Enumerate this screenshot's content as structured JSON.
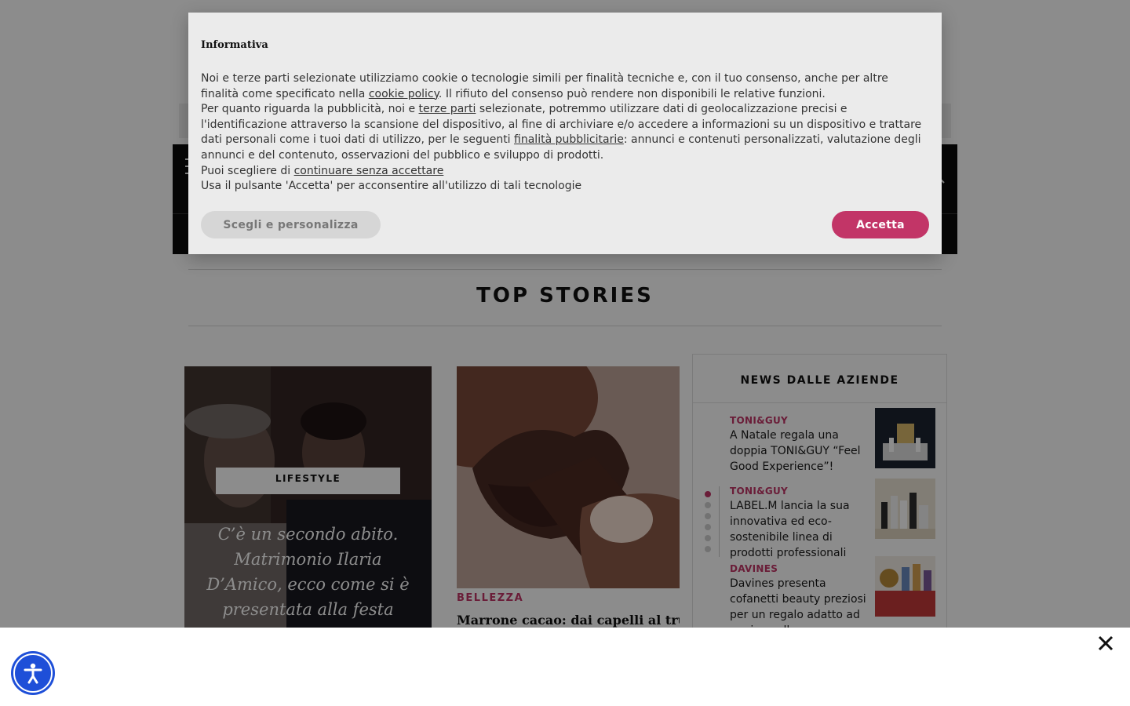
{
  "colors": {
    "accent": "#c23567",
    "dark": "#0e0e0e",
    "a11y": "#1e4fd8"
  },
  "section": {
    "title": "TOP STORIES"
  },
  "card1": {
    "category": "LIFESTYLE",
    "title": "C’è un secondo abito. Matrimonio Ilaria D’Amico, ecco come si è presentata alla festa"
  },
  "card2": {
    "category": "BELLEZZA",
    "title": "Marrone cacao: dai capelli al trucco il"
  },
  "news": {
    "title": "NEWS DALLE AZIENDE",
    "active_slide": 1,
    "slide_count": 6,
    "items": [
      {
        "brand": "TONI&GUY",
        "headline": "A Natale regala una doppia TONI&GUY “Feel Good Experience”!"
      },
      {
        "brand": "TONI&GUY",
        "headline": "LABEL.M lancia la sua innovativa ed eco-sostenibile linea di prodotti professionali"
      },
      {
        "brand": "DAVINES",
        "headline": "Davines presenta cofanetti beauty preziosi per un regalo adatto ad ogni capello"
      }
    ]
  },
  "modal": {
    "title": "Informativa",
    "p1_a": "Noi e terze parti selezionate utilizziamo cookie o tecnologie simili per finalità tecniche e, con il tuo consenso, anche per altre finalità come specificato nella ",
    "p1_link": "cookie policy",
    "p1_b": ". Il rifiuto del consenso può rendere non disponibili le relative funzioni.",
    "p2_a": "Per quanto riguarda la pubblicità, noi e ",
    "p2_link1": "terze parti",
    "p2_b": " selezionate, potremmo utilizzare dati di geolocalizzazione precisi e l'identificazione attraverso la scansione del dispositivo, al fine di archiviare e/o accedere a informazioni su un dispositivo e trattare dati personali come i tuoi dati di utilizzo, per le seguenti ",
    "p2_link2": "finalità pubblicitarie",
    "p2_c": ": annunci e contenuti personalizzati, valutazione degli annunci e del contenuto, osservazioni del pubblico e sviluppo di prodotti.",
    "p3_a": "Puoi scegliere di ",
    "p3_link": "continuare senza accettare",
    "p4": "Usa il pulsante 'Accetta' per acconsentire all'utilizzo di tali tecnologie",
    "btn_customize": "Scegli e personalizza",
    "btn_accept": "Accetta"
  },
  "icons": {
    "menu": "hamburger-icon",
    "search": "search-icon",
    "close": "close-icon",
    "accessibility": "accessibility-icon"
  }
}
